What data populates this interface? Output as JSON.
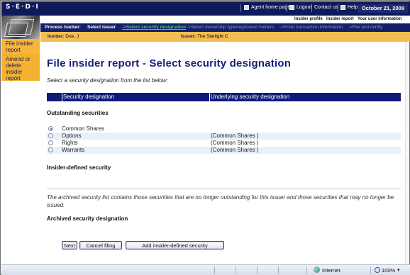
{
  "topbar": {
    "logo": "S·E·D·I",
    "links": [
      {
        "label": "Agent home page",
        "icon": "home-icon"
      },
      {
        "label": "Logout",
        "icon": "logout-icon"
      },
      {
        "label": "Contact us",
        "icon": "contact-icon"
      },
      {
        "label": "Help",
        "icon": "help-icon"
      }
    ],
    "date": "October 21, 2009"
  },
  "sidebar": {
    "items": [
      {
        "label": "File insider report"
      },
      {
        "label": "Amend or delete insider report"
      }
    ]
  },
  "subnav": {
    "links": [
      "Insider profile",
      "Insider report",
      "Your user information"
    ]
  },
  "tracker": {
    "label": "Process tracker:",
    "steps": [
      "Select issuer",
      "->Select security designation",
      "->Select ownership type/registered holders",
      "->Enter transaction information",
      "->File and certify"
    ]
  },
  "info": {
    "insider_label": "Insider:",
    "insider_value": "Doe, J",
    "issuer_label": "Issuer:",
    "issuer_value": "The Starlight C"
  },
  "page": {
    "title": "File insider report - Select security designation",
    "instruction": "Select a security designation from the list below:"
  },
  "table": {
    "headers": [
      "Security designation",
      "Underlying security designation"
    ],
    "outstanding_heading": "Outstanding securities",
    "rows": [
      {
        "name": "Common Shares",
        "underlying": "",
        "selected": true
      },
      {
        "name": "Options",
        "underlying": "(Common Shares )",
        "selected": false
      },
      {
        "name": "Rights",
        "underlying": "(Common Shares )",
        "selected": false
      },
      {
        "name": "Warrants",
        "underlying": "(Common Shares )",
        "selected": false
      }
    ],
    "insider_defined_heading": "Insider-defined security",
    "archived_note": "The archived security list contains those securities that are no longer outstanding for this issuer and those securities that may no longer be issued.",
    "archived_heading": "Archived security designation"
  },
  "buttons": {
    "next": "Next",
    "cancel": "Cancel filing",
    "add": "Add insider-defined security"
  },
  "statusbar": {
    "zone": "Internet",
    "zoom": "100%"
  }
}
